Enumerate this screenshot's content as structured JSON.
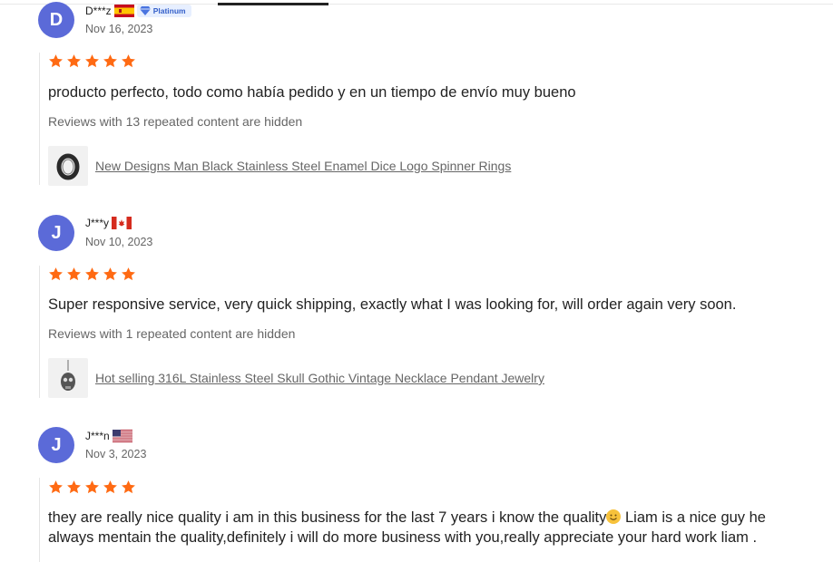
{
  "reviews": [
    {
      "initial": "D",
      "name": "D***z",
      "country_flag": "spain-flag-icon",
      "badge": "Platinum",
      "date": "Nov 16, 2023",
      "rating": 5,
      "text": "producto perfecto, todo como había pedido y en un tiempo de envío muy bueno",
      "hidden_note": "Reviews with 13 repeated content are hidden",
      "product": "New Designs Man Black Stainless Steel Enamel Dice Logo Spinner Rings",
      "product_icon": "ring-icon"
    },
    {
      "initial": "J",
      "name": "J***y",
      "country_flag": "canada-flag-icon",
      "date": "Nov 10, 2023",
      "rating": 5,
      "text": "Super responsive service, very quick shipping, exactly what I was looking for, will order again very soon.",
      "hidden_note": "Reviews with 1 repeated content are hidden",
      "product": "Hot selling 316L Stainless Steel Skull Gothic Vintage Necklace Pendant Jewelry",
      "product_icon": "skull-pendant-icon"
    },
    {
      "initial": "J",
      "name": "J***n",
      "country_flag": "usa-flag-icon",
      "date": "Nov 3, 2023",
      "rating": 5,
      "text_before_emoji": "they are really nice quality i am in this business for the last 7 years i know the quality",
      "emoji": "smiling-face-emoji",
      "text_after_emoji": "Liam is a nice guy he always mentain the quality,definitely i will do more business with you,really appreciate your hard work liam ."
    }
  ],
  "colors": {
    "avatar": "#5b6ad8",
    "star": "#ff6a13",
    "text": "#222222",
    "muted": "#666666"
  }
}
